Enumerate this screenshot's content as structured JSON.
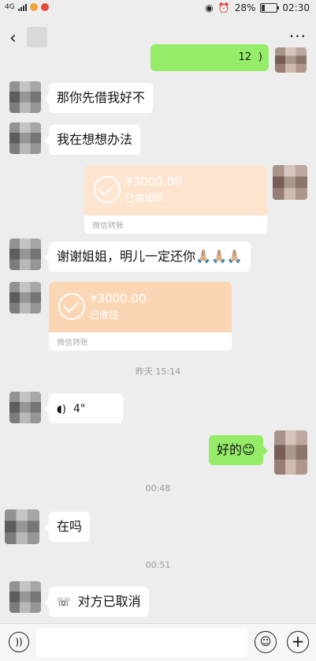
{
  "status_bar": {
    "network": "4G",
    "battery": "28%",
    "time": "02:30"
  },
  "header": {
    "back_icon": "chevron-left-icon",
    "more_icon": "more-dots-icon"
  },
  "messages": [
    {
      "type": "text",
      "side": "left",
      "text": "那你先借我好不"
    },
    {
      "type": "text",
      "side": "left",
      "text": "我在想想办法"
    },
    {
      "type": "transfer",
      "side": "right",
      "amount": "¥3000.00",
      "status": "已被领取",
      "source": "微信转账"
    },
    {
      "type": "text",
      "side": "left",
      "text": "谢谢姐姐，明儿一定还你",
      "emoji": "🙏🏼🙏🏼🙏🏼"
    },
    {
      "type": "transfer",
      "side": "left",
      "amount": "¥3000.00",
      "status": "已收钱",
      "source": "微信转账"
    },
    {
      "type": "time",
      "text": "昨天 15:14"
    },
    {
      "type": "voice",
      "side": "left",
      "text": "4\""
    },
    {
      "type": "text",
      "side": "right",
      "text": "好的",
      "emoji": "😊"
    },
    {
      "type": "time",
      "text": "00:48"
    },
    {
      "type": "text",
      "side": "left",
      "text": "在吗"
    },
    {
      "type": "time",
      "text": "00:51"
    },
    {
      "type": "call",
      "side": "left",
      "text": "对方已取消"
    }
  ],
  "top_partial": {
    "text": "12"
  }
}
